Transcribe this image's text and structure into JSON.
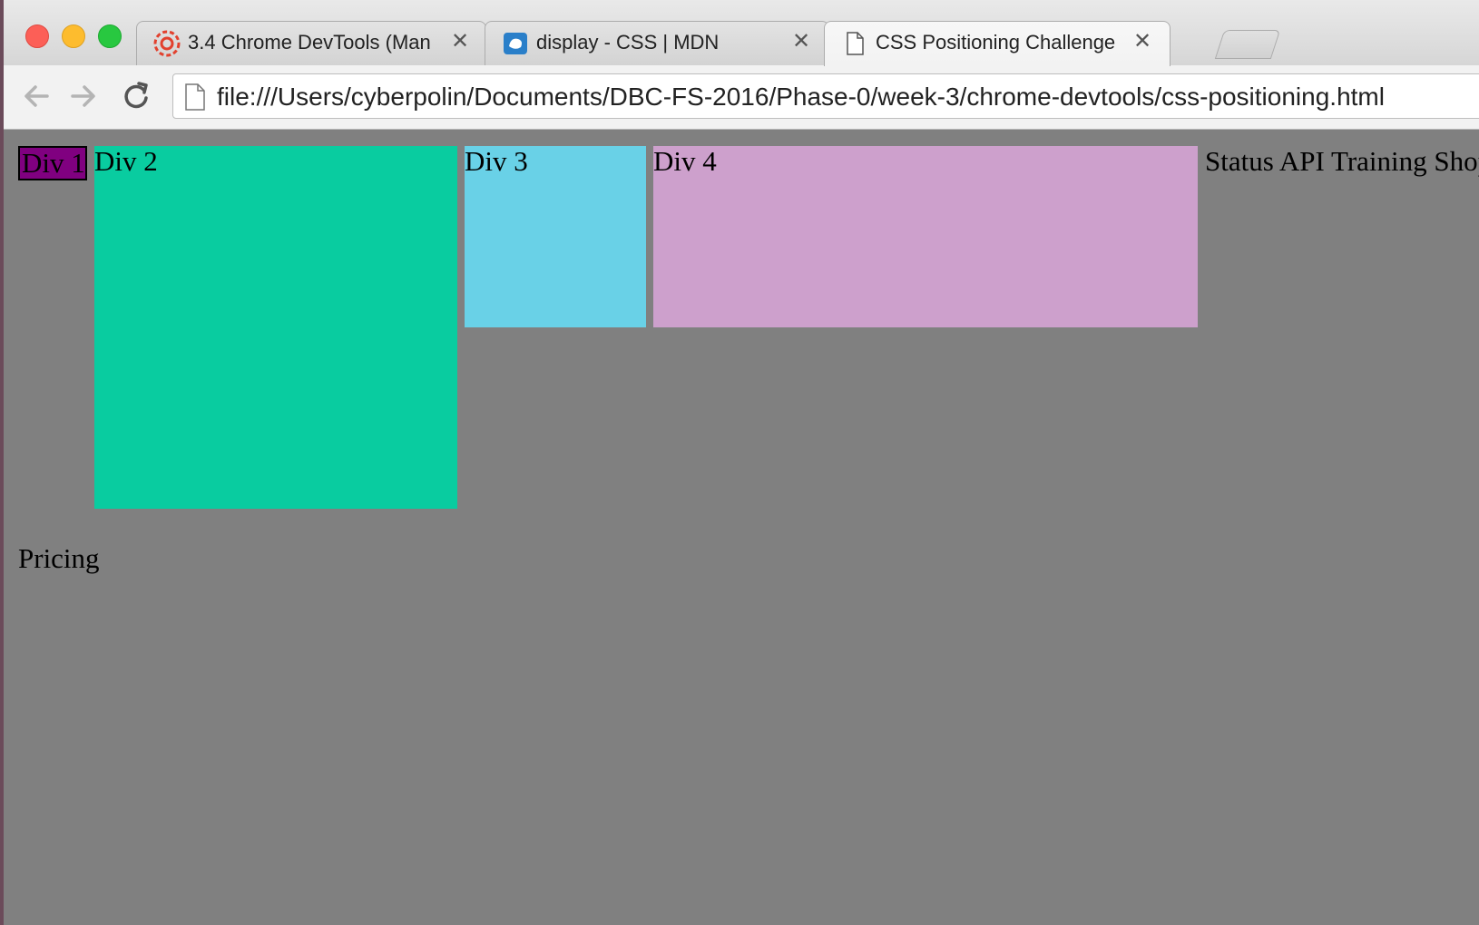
{
  "browser": {
    "tabs": [
      {
        "title": "3.4 Chrome DevTools (Man",
        "favicon": "canvas-logo-icon",
        "active": false
      },
      {
        "title": "display - CSS | MDN",
        "favicon": "mdn-logo-icon",
        "active": false
      },
      {
        "title": "CSS Positioning Challenge",
        "favicon": "document-icon",
        "active": true
      }
    ],
    "close_glyph": "✕",
    "url": "file:///Users/cyberpolin/Documents/DBC-FS-2016/Phase-0/week-3/chrome-devtools/css-positioning.html"
  },
  "page": {
    "background": "#808080",
    "boxes": [
      {
        "label": "Div 1",
        "color": "#800080"
      },
      {
        "label": "Div 2",
        "color": "#09cca0"
      },
      {
        "label": "Div 3",
        "color": "#69d1e7"
      },
      {
        "label": "Div 4",
        "color": "#cda0cc"
      }
    ],
    "nav_text": "Status API Training Shop",
    "footer_text": "Pricing"
  }
}
